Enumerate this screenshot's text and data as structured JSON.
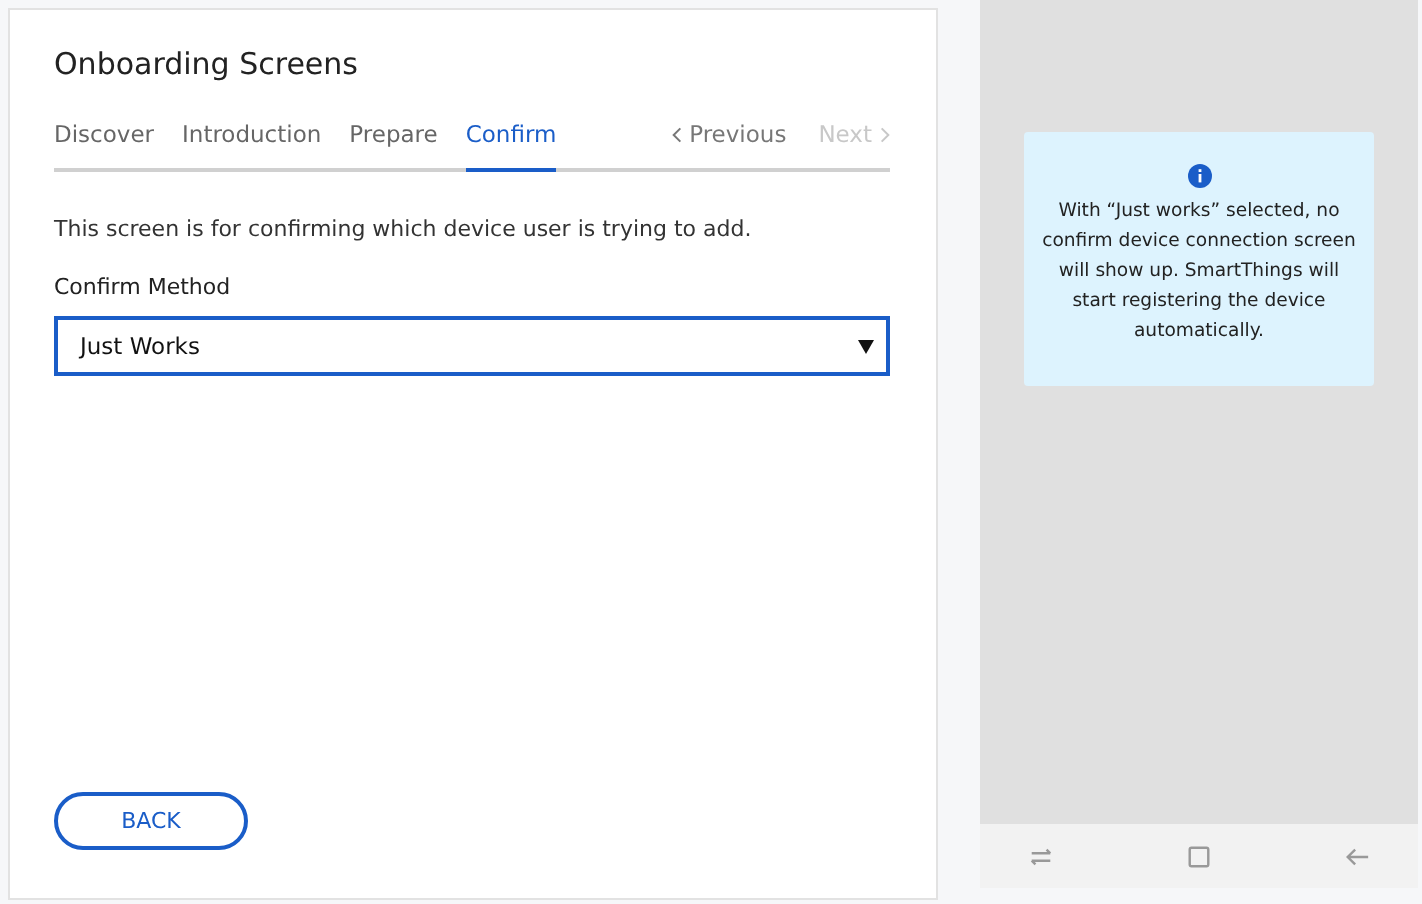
{
  "title": "Onboarding Screens",
  "tabs": [
    {
      "label": "Discover",
      "selected": false
    },
    {
      "label": "Introduction",
      "selected": false
    },
    {
      "label": "Prepare",
      "selected": false
    },
    {
      "label": "Confirm",
      "selected": true
    }
  ],
  "nav": [
    {
      "label": "Previous",
      "kind": "prev",
      "disabled": false
    },
    {
      "label": "Next",
      "kind": "next",
      "disabled": true
    }
  ],
  "description": "This screen is for confirming which device user is trying to add.",
  "field": {
    "label": "Confirm Method",
    "value": "Just Works"
  },
  "back_button": "BACK",
  "preview": {
    "info": "With “Just works” selected, no confirm device connection screen will show up. SmartThings will start registering the device automatically."
  }
}
